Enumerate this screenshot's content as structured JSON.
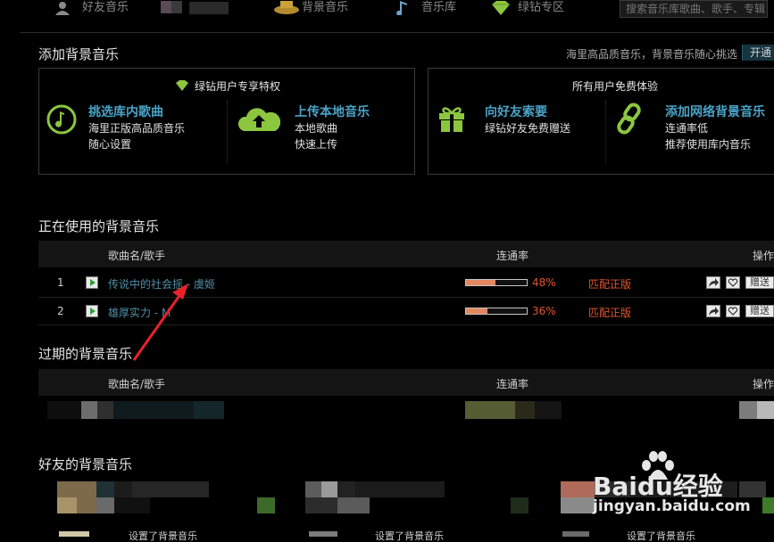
{
  "nav": {
    "items": [
      {
        "label": "好友音乐",
        "icon": "user-icon"
      },
      {
        "label": "",
        "icon": "album-icon"
      },
      {
        "label": "背景音乐",
        "icon": "music-box-icon"
      },
      {
        "label": "音乐库",
        "icon": "music-note-icon"
      },
      {
        "label": "绿钻专区",
        "icon": "diamond-icon"
      }
    ],
    "search_placeholder": "搜索音乐库歌曲、歌手、专辑"
  },
  "add_section": {
    "title": "添加背景音乐",
    "promo": "海里高品质音乐，背景音乐随心挑选",
    "open_button": "开通",
    "green_card": {
      "header": "绿钻用户专享特权",
      "features": [
        {
          "title": "挑选库内歌曲",
          "desc1": "海里正版高品质音乐",
          "desc2": "随心设置",
          "icon": "music-note-circle-icon"
        },
        {
          "title": "上传本地音乐",
          "desc1": "本地歌曲",
          "desc2": "快速上传",
          "icon": "cloud-upload-icon"
        }
      ]
    },
    "free_card": {
      "header": "所有用户免费体验",
      "features": [
        {
          "title": "向好友索要",
          "desc1": "绿钻好友免费赠送",
          "desc2": "",
          "icon": "gift-icon"
        },
        {
          "title": "添加网络背景音乐",
          "desc1": "连通率低",
          "desc2": "推荐使用库内音乐",
          "icon": "link-icon"
        }
      ]
    }
  },
  "using_section": {
    "title": "正在使用的背景音乐",
    "col_song": "歌曲名/歌手",
    "col_rate": "连通率",
    "col_op": "操作",
    "rows": [
      {
        "index": "1",
        "song": "传说中的社会摇 - 虞姬",
        "rate_text": "48%",
        "rate": 0.48,
        "match": "匹配正版",
        "gift": "赠送"
      },
      {
        "index": "2",
        "song": "雄厚实力 - M",
        "rate_text": "36%",
        "rate": 0.36,
        "match": "匹配正版",
        "gift": "赠送"
      }
    ]
  },
  "expired_section": {
    "title": "过期的背景音乐",
    "col_song": "歌曲名/歌手",
    "col_rate": "连通率",
    "col_op": "操作"
  },
  "friends_section": {
    "title": "好友的背景音乐",
    "items": [
      {
        "text": "设置了背景音乐"
      },
      {
        "text": "设置了背景音乐"
      },
      {
        "text": "设置了背景音乐"
      }
    ]
  },
  "watermark": {
    "brand": "Baidu经验",
    "url": "jingyan.baidu.com"
  },
  "colors": {
    "accent_blue": "#4aa3c7",
    "green_icon": "#8cc63f",
    "rate_red": "#e3552d",
    "bar_fill": "#e28760"
  }
}
